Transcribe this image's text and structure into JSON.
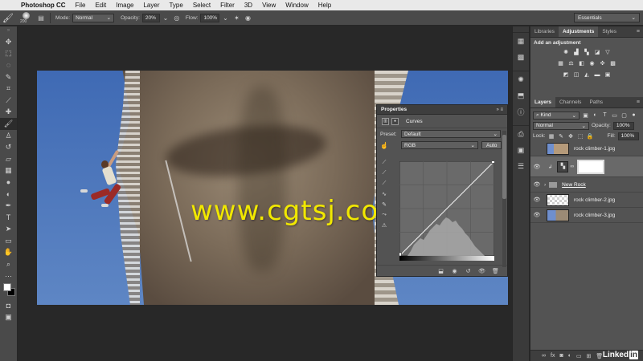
{
  "menubar": {
    "app_name": "Photoshop CC",
    "items": [
      "File",
      "Edit",
      "Image",
      "Layer",
      "Type",
      "Select",
      "Filter",
      "3D",
      "View",
      "Window",
      "Help"
    ]
  },
  "options_bar": {
    "brush_size": "200",
    "mode_label": "Mode:",
    "mode_value": "Normal",
    "opacity_label": "Opacity:",
    "opacity_value": "20%",
    "flow_label": "Flow:",
    "flow_value": "100%",
    "workspace": "Essentials"
  },
  "watermark": "www.cgtsj.com",
  "properties": {
    "tab_label": "Properties",
    "adjustment_name": "Curves",
    "preset_label": "Preset:",
    "preset_value": "Default",
    "channel_value": "RGB",
    "auto_label": "Auto"
  },
  "adjustments_panel": {
    "tabs": [
      "Libraries",
      "Adjustments",
      "Styles"
    ],
    "title": "Add an adjustment"
  },
  "layers_panel": {
    "tabs": [
      "Layers",
      "Channels",
      "Paths"
    ],
    "kind_label": "Kind",
    "blend_mode": "Normal",
    "opacity_label": "Opacity:",
    "opacity_value": "100%",
    "lock_label": "Lock:",
    "fill_label": "Fill:",
    "fill_value": "100%",
    "layers": [
      {
        "name": "rock climber-1.jpg",
        "visible": false
      },
      {
        "name": "",
        "visible": true
      },
      {
        "name": "New Rock",
        "visible": true
      },
      {
        "name": "rock climber-2.jpg",
        "visible": true
      },
      {
        "name": "rock climber-3.jpg",
        "visible": true
      }
    ]
  },
  "brand": {
    "text": "Linked",
    "badge": "in"
  },
  "colors": {
    "foreground": "#ffffff",
    "background": "#000000",
    "watermark": "#f1e800"
  }
}
